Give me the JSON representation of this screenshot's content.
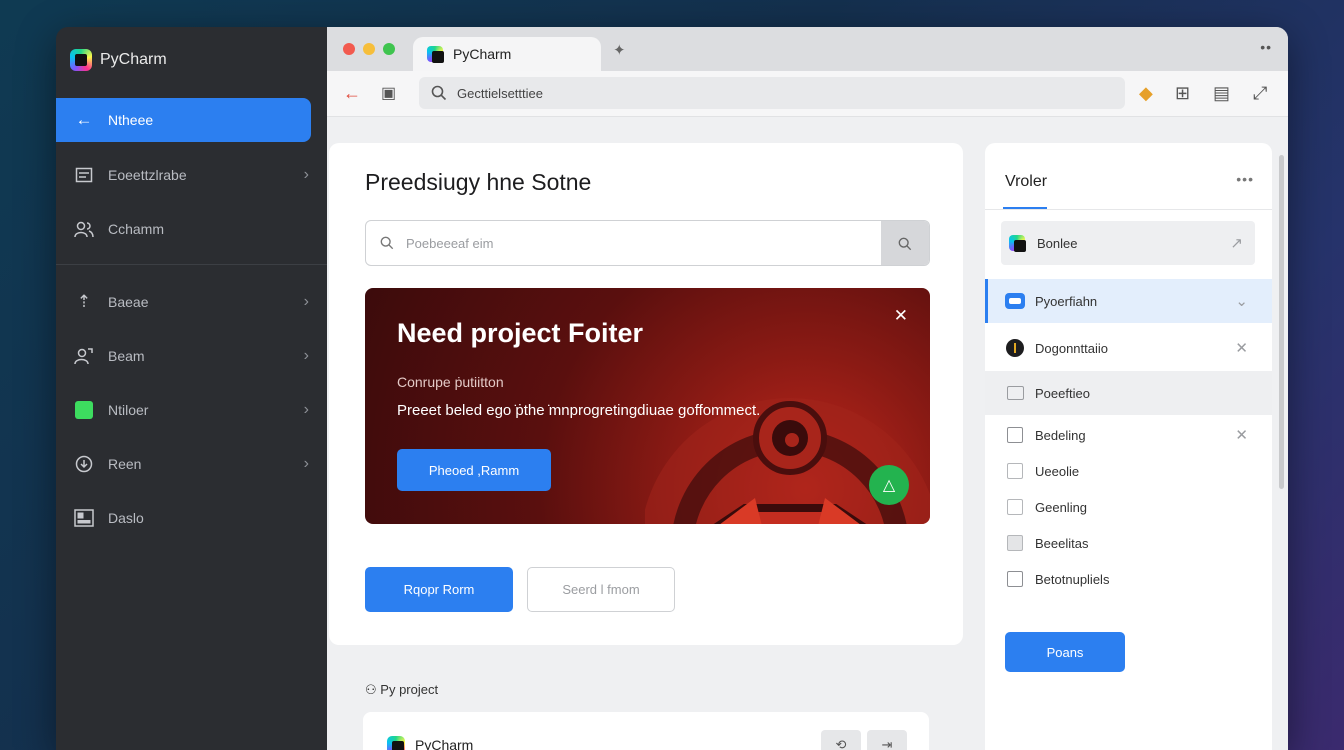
{
  "sidebar": {
    "brand": "PyCharm",
    "items": [
      {
        "label": "Ntheee",
        "icon": "arrow-left-icon"
      },
      {
        "label": "Eoeettzlrabe",
        "icon": "list-icon"
      },
      {
        "label": "Cchamm",
        "icon": "people-icon"
      },
      {
        "label": "Baeae",
        "icon": "upload-icon"
      },
      {
        "label": "Beam",
        "icon": "user-edit-icon"
      },
      {
        "label": "Ntiloer",
        "icon": "folder-green-icon"
      },
      {
        "label": "Reen",
        "icon": "download-circle-icon"
      },
      {
        "label": "Daslo",
        "icon": "layout-icon"
      }
    ]
  },
  "browser": {
    "tab_title": "PyCharm",
    "address": "Gecttielsetttiee",
    "colors": {
      "close": "#f25a4f",
      "minimize": "#f6be3b",
      "maximize": "#3fc44f"
    }
  },
  "main": {
    "page_title": "Preedsiugy hne Sotne",
    "search_placeholder": "Poebeeeaf eim",
    "banner": {
      "title": "Need project Foiter",
      "subtitle": "Conrupe ṗutiitton",
      "description": "Preeet beled ego ̇ṗthe ̇mnprogretingdiuae goffommect.",
      "button": "Pheoed ,Ramm"
    },
    "primary_button": "Rqopr Rorm",
    "secondary_button": "Seerd l fmom",
    "section_label": "Py project",
    "project_card": {
      "name": "PyCharm",
      "btn1": "⟲",
      "btn2": "⇥"
    }
  },
  "panel": {
    "title": "Vroler",
    "rows": [
      {
        "label": "Bonlee",
        "icon": "pycharm-icon",
        "trail": "↗"
      },
      {
        "label": "Pyoerfiahn",
        "icon": "python-file-icon",
        "trail": "⌄"
      },
      {
        "label": "Dogonnttaiio",
        "icon": "dark-circle-icon",
        "trail": "✕"
      },
      {
        "label": "Poeeftieo",
        "icon": "file-icon",
        "trail": ""
      },
      {
        "label": "Bedeling",
        "icon": "checkbox-icon",
        "trail": "✕"
      },
      {
        "label": "Ueeolie",
        "icon": "doc-icon",
        "trail": ""
      },
      {
        "label": "Geenling",
        "icon": "doc-icon",
        "trail": ""
      },
      {
        "label": "Beeelitas",
        "icon": "doc-icon",
        "trail": ""
      },
      {
        "label": "Betotnupliels",
        "icon": "checkbox-icon",
        "trail": ""
      }
    ],
    "button": "Poans"
  }
}
